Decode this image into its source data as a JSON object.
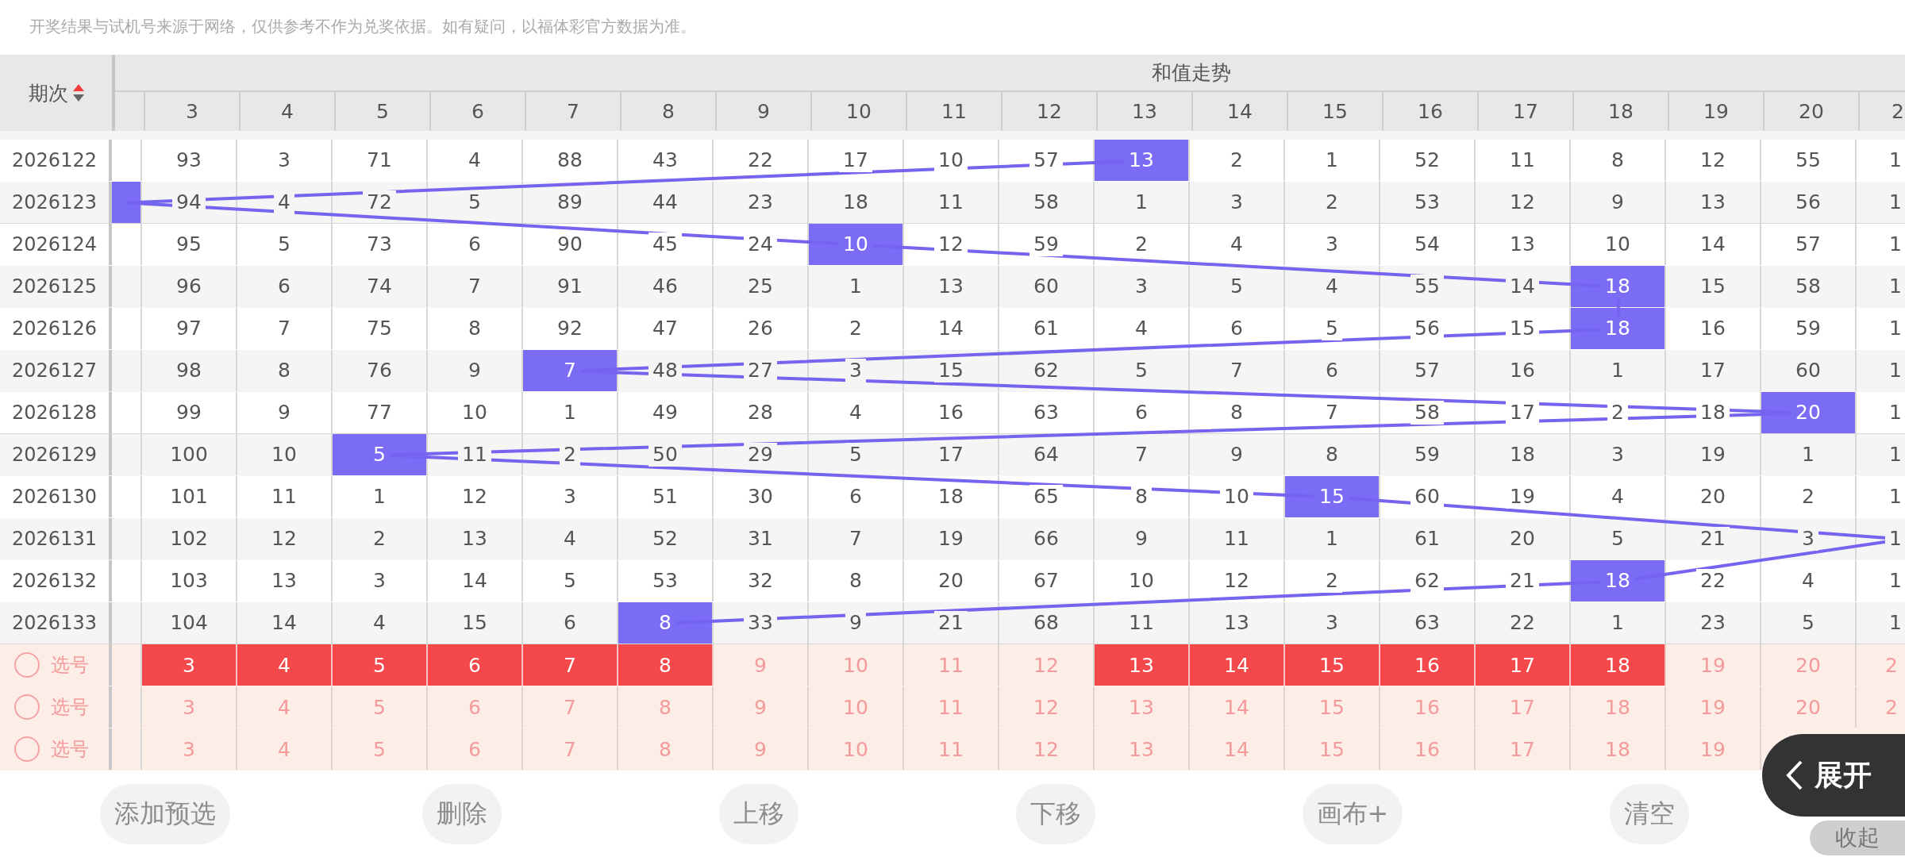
{
  "notice": "开奖结果与试机号来源于网络，仅供参考不作为兑奖依据。如有疑问，以福体彩官方数据为准。",
  "table": {
    "issue_header": "期次",
    "group_header": "和值走势",
    "columns": [
      "3",
      "4",
      "5",
      "6",
      "7",
      "8",
      "9",
      "10",
      "11",
      "12",
      "13",
      "14",
      "15",
      "16",
      "17",
      "18",
      "19",
      "20",
      "2"
    ],
    "rows": [
      {
        "issue": "2026122",
        "edge_hit": false,
        "beyond_hit": false,
        "cells": [
          {
            "text": "93",
            "hit": false
          },
          {
            "text": "3",
            "hit": false
          },
          {
            "text": "71",
            "hit": false
          },
          {
            "text": "4",
            "hit": false
          },
          {
            "text": "88",
            "hit": false
          },
          {
            "text": "43",
            "hit": false
          },
          {
            "text": "22",
            "hit": false
          },
          {
            "text": "17",
            "hit": false
          },
          {
            "text": "10",
            "hit": false
          },
          {
            "text": "57",
            "hit": false
          },
          {
            "text": "13",
            "hit": true
          },
          {
            "text": "2",
            "hit": false
          },
          {
            "text": "1",
            "hit": false
          },
          {
            "text": "52",
            "hit": false
          },
          {
            "text": "11",
            "hit": false
          },
          {
            "text": "8",
            "hit": false
          },
          {
            "text": "12",
            "hit": false
          },
          {
            "text": "55",
            "hit": false
          },
          {
            "text": "1",
            "hit": false
          }
        ]
      },
      {
        "issue": "2026123",
        "edge_hit": true,
        "beyond_hit": false,
        "cells": [
          {
            "text": "94",
            "hit": false
          },
          {
            "text": "4",
            "hit": false
          },
          {
            "text": "72",
            "hit": false
          },
          {
            "text": "5",
            "hit": false
          },
          {
            "text": "89",
            "hit": false
          },
          {
            "text": "44",
            "hit": false
          },
          {
            "text": "23",
            "hit": false
          },
          {
            "text": "18",
            "hit": false
          },
          {
            "text": "11",
            "hit": false
          },
          {
            "text": "58",
            "hit": false
          },
          {
            "text": "1",
            "hit": false
          },
          {
            "text": "3",
            "hit": false
          },
          {
            "text": "2",
            "hit": false
          },
          {
            "text": "53",
            "hit": false
          },
          {
            "text": "12",
            "hit": false
          },
          {
            "text": "9",
            "hit": false
          },
          {
            "text": "13",
            "hit": false
          },
          {
            "text": "56",
            "hit": false
          },
          {
            "text": "1",
            "hit": false
          }
        ]
      },
      {
        "issue": "2026124",
        "edge_hit": false,
        "beyond_hit": false,
        "cells": [
          {
            "text": "95",
            "hit": false
          },
          {
            "text": "5",
            "hit": false
          },
          {
            "text": "73",
            "hit": false
          },
          {
            "text": "6",
            "hit": false
          },
          {
            "text": "90",
            "hit": false
          },
          {
            "text": "45",
            "hit": false
          },
          {
            "text": "24",
            "hit": false
          },
          {
            "text": "10",
            "hit": true
          },
          {
            "text": "12",
            "hit": false
          },
          {
            "text": "59",
            "hit": false
          },
          {
            "text": "2",
            "hit": false
          },
          {
            "text": "4",
            "hit": false
          },
          {
            "text": "3",
            "hit": false
          },
          {
            "text": "54",
            "hit": false
          },
          {
            "text": "13",
            "hit": false
          },
          {
            "text": "10",
            "hit": false
          },
          {
            "text": "14",
            "hit": false
          },
          {
            "text": "57",
            "hit": false
          },
          {
            "text": "1",
            "hit": false
          }
        ]
      },
      {
        "issue": "2026125",
        "edge_hit": false,
        "beyond_hit": false,
        "cells": [
          {
            "text": "96",
            "hit": false
          },
          {
            "text": "6",
            "hit": false
          },
          {
            "text": "74",
            "hit": false
          },
          {
            "text": "7",
            "hit": false
          },
          {
            "text": "91",
            "hit": false
          },
          {
            "text": "46",
            "hit": false
          },
          {
            "text": "25",
            "hit": false
          },
          {
            "text": "1",
            "hit": false
          },
          {
            "text": "13",
            "hit": false
          },
          {
            "text": "60",
            "hit": false
          },
          {
            "text": "3",
            "hit": false
          },
          {
            "text": "5",
            "hit": false
          },
          {
            "text": "4",
            "hit": false
          },
          {
            "text": "55",
            "hit": false
          },
          {
            "text": "14",
            "hit": false
          },
          {
            "text": "18",
            "hit": true
          },
          {
            "text": "15",
            "hit": false
          },
          {
            "text": "58",
            "hit": false
          },
          {
            "text": "1",
            "hit": false
          }
        ]
      },
      {
        "issue": "2026126",
        "edge_hit": false,
        "beyond_hit": false,
        "cells": [
          {
            "text": "97",
            "hit": false
          },
          {
            "text": "7",
            "hit": false
          },
          {
            "text": "75",
            "hit": false
          },
          {
            "text": "8",
            "hit": false
          },
          {
            "text": "92",
            "hit": false
          },
          {
            "text": "47",
            "hit": false
          },
          {
            "text": "26",
            "hit": false
          },
          {
            "text": "2",
            "hit": false
          },
          {
            "text": "14",
            "hit": false
          },
          {
            "text": "61",
            "hit": false
          },
          {
            "text": "4",
            "hit": false
          },
          {
            "text": "6",
            "hit": false
          },
          {
            "text": "5",
            "hit": false
          },
          {
            "text": "56",
            "hit": false
          },
          {
            "text": "15",
            "hit": false
          },
          {
            "text": "18",
            "hit": true
          },
          {
            "text": "16",
            "hit": false
          },
          {
            "text": "59",
            "hit": false
          },
          {
            "text": "1",
            "hit": false
          }
        ]
      },
      {
        "issue": "2026127",
        "edge_hit": false,
        "beyond_hit": false,
        "cells": [
          {
            "text": "98",
            "hit": false
          },
          {
            "text": "8",
            "hit": false
          },
          {
            "text": "76",
            "hit": false
          },
          {
            "text": "9",
            "hit": false
          },
          {
            "text": "7",
            "hit": true
          },
          {
            "text": "48",
            "hit": false
          },
          {
            "text": "27",
            "hit": false
          },
          {
            "text": "3",
            "hit": false
          },
          {
            "text": "15",
            "hit": false
          },
          {
            "text": "62",
            "hit": false
          },
          {
            "text": "5",
            "hit": false
          },
          {
            "text": "7",
            "hit": false
          },
          {
            "text": "6",
            "hit": false
          },
          {
            "text": "57",
            "hit": false
          },
          {
            "text": "16",
            "hit": false
          },
          {
            "text": "1",
            "hit": false
          },
          {
            "text": "17",
            "hit": false
          },
          {
            "text": "60",
            "hit": false
          },
          {
            "text": "1",
            "hit": false
          }
        ]
      },
      {
        "issue": "2026128",
        "edge_hit": false,
        "beyond_hit": false,
        "cells": [
          {
            "text": "99",
            "hit": false
          },
          {
            "text": "9",
            "hit": false
          },
          {
            "text": "77",
            "hit": false
          },
          {
            "text": "10",
            "hit": false
          },
          {
            "text": "1",
            "hit": false
          },
          {
            "text": "49",
            "hit": false
          },
          {
            "text": "28",
            "hit": false
          },
          {
            "text": "4",
            "hit": false
          },
          {
            "text": "16",
            "hit": false
          },
          {
            "text": "63",
            "hit": false
          },
          {
            "text": "6",
            "hit": false
          },
          {
            "text": "8",
            "hit": false
          },
          {
            "text": "7",
            "hit": false
          },
          {
            "text": "58",
            "hit": false
          },
          {
            "text": "17",
            "hit": false
          },
          {
            "text": "2",
            "hit": false
          },
          {
            "text": "18",
            "hit": false
          },
          {
            "text": "20",
            "hit": true
          },
          {
            "text": "1",
            "hit": false
          }
        ]
      },
      {
        "issue": "2026129",
        "edge_hit": false,
        "beyond_hit": false,
        "cells": [
          {
            "text": "100",
            "hit": false
          },
          {
            "text": "10",
            "hit": false
          },
          {
            "text": "5",
            "hit": true
          },
          {
            "text": "11",
            "hit": false
          },
          {
            "text": "2",
            "hit": false
          },
          {
            "text": "50",
            "hit": false
          },
          {
            "text": "29",
            "hit": false
          },
          {
            "text": "5",
            "hit": false
          },
          {
            "text": "17",
            "hit": false
          },
          {
            "text": "64",
            "hit": false
          },
          {
            "text": "7",
            "hit": false
          },
          {
            "text": "9",
            "hit": false
          },
          {
            "text": "8",
            "hit": false
          },
          {
            "text": "59",
            "hit": false
          },
          {
            "text": "18",
            "hit": false
          },
          {
            "text": "3",
            "hit": false
          },
          {
            "text": "19",
            "hit": false
          },
          {
            "text": "1",
            "hit": false
          },
          {
            "text": "1",
            "hit": false
          }
        ]
      },
      {
        "issue": "2026130",
        "edge_hit": false,
        "beyond_hit": false,
        "cells": [
          {
            "text": "101",
            "hit": false
          },
          {
            "text": "11",
            "hit": false
          },
          {
            "text": "1",
            "hit": false
          },
          {
            "text": "12",
            "hit": false
          },
          {
            "text": "3",
            "hit": false
          },
          {
            "text": "51",
            "hit": false
          },
          {
            "text": "30",
            "hit": false
          },
          {
            "text": "6",
            "hit": false
          },
          {
            "text": "18",
            "hit": false
          },
          {
            "text": "65",
            "hit": false
          },
          {
            "text": "8",
            "hit": false
          },
          {
            "text": "10",
            "hit": false
          },
          {
            "text": "15",
            "hit": true
          },
          {
            "text": "60",
            "hit": false
          },
          {
            "text": "19",
            "hit": false
          },
          {
            "text": "4",
            "hit": false
          },
          {
            "text": "20",
            "hit": false
          },
          {
            "text": "2",
            "hit": false
          },
          {
            "text": "1",
            "hit": false
          }
        ]
      },
      {
        "issue": "2026131",
        "edge_hit": false,
        "beyond_hit": true,
        "cells": [
          {
            "text": "102",
            "hit": false
          },
          {
            "text": "12",
            "hit": false
          },
          {
            "text": "2",
            "hit": false
          },
          {
            "text": "13",
            "hit": false
          },
          {
            "text": "4",
            "hit": false
          },
          {
            "text": "52",
            "hit": false
          },
          {
            "text": "31",
            "hit": false
          },
          {
            "text": "7",
            "hit": false
          },
          {
            "text": "19",
            "hit": false
          },
          {
            "text": "66",
            "hit": false
          },
          {
            "text": "9",
            "hit": false
          },
          {
            "text": "11",
            "hit": false
          },
          {
            "text": "1",
            "hit": false
          },
          {
            "text": "61",
            "hit": false
          },
          {
            "text": "20",
            "hit": false
          },
          {
            "text": "5",
            "hit": false
          },
          {
            "text": "21",
            "hit": false
          },
          {
            "text": "3",
            "hit": false
          },
          {
            "text": "1",
            "hit": false
          }
        ]
      },
      {
        "issue": "2026132",
        "edge_hit": false,
        "beyond_hit": false,
        "cells": [
          {
            "text": "103",
            "hit": false
          },
          {
            "text": "13",
            "hit": false
          },
          {
            "text": "3",
            "hit": false
          },
          {
            "text": "14",
            "hit": false
          },
          {
            "text": "5",
            "hit": false
          },
          {
            "text": "53",
            "hit": false
          },
          {
            "text": "32",
            "hit": false
          },
          {
            "text": "8",
            "hit": false
          },
          {
            "text": "20",
            "hit": false
          },
          {
            "text": "67",
            "hit": false
          },
          {
            "text": "10",
            "hit": false
          },
          {
            "text": "12",
            "hit": false
          },
          {
            "text": "2",
            "hit": false
          },
          {
            "text": "62",
            "hit": false
          },
          {
            "text": "21",
            "hit": false
          },
          {
            "text": "18",
            "hit": true
          },
          {
            "text": "22",
            "hit": false
          },
          {
            "text": "4",
            "hit": false
          },
          {
            "text": "1",
            "hit": false
          }
        ]
      },
      {
        "issue": "2026133",
        "edge_hit": false,
        "beyond_hit": false,
        "cells": [
          {
            "text": "104",
            "hit": false
          },
          {
            "text": "14",
            "hit": false
          },
          {
            "text": "4",
            "hit": false
          },
          {
            "text": "15",
            "hit": false
          },
          {
            "text": "6",
            "hit": false
          },
          {
            "text": "8",
            "hit": true
          },
          {
            "text": "33",
            "hit": false
          },
          {
            "text": "9",
            "hit": false
          },
          {
            "text": "21",
            "hit": false
          },
          {
            "text": "68",
            "hit": false
          },
          {
            "text": "11",
            "hit": false
          },
          {
            "text": "13",
            "hit": false
          },
          {
            "text": "3",
            "hit": false
          },
          {
            "text": "63",
            "hit": false
          },
          {
            "text": "22",
            "hit": false
          },
          {
            "text": "1",
            "hit": false
          },
          {
            "text": "23",
            "hit": false
          },
          {
            "text": "5",
            "hit": false
          },
          {
            "text": "1",
            "hit": false
          }
        ]
      }
    ],
    "pick_rows": [
      {
        "label": "选号",
        "checked": false,
        "cells": [
          {
            "text": "3",
            "selected": true
          },
          {
            "text": "4",
            "selected": true
          },
          {
            "text": "5",
            "selected": true
          },
          {
            "text": "6",
            "selected": true
          },
          {
            "text": "7",
            "selected": true
          },
          {
            "text": "8",
            "selected": true
          },
          {
            "text": "9",
            "selected": false
          },
          {
            "text": "10",
            "selected": false
          },
          {
            "text": "11",
            "selected": false
          },
          {
            "text": "12",
            "selected": false
          },
          {
            "text": "13",
            "selected": true
          },
          {
            "text": "14",
            "selected": true
          },
          {
            "text": "15",
            "selected": true
          },
          {
            "text": "16",
            "selected": true
          },
          {
            "text": "17",
            "selected": true
          },
          {
            "text": "18",
            "selected": true
          },
          {
            "text": "19",
            "selected": false
          },
          {
            "text": "20",
            "selected": false
          },
          {
            "text": "2",
            "selected": false
          }
        ]
      },
      {
        "label": "选号",
        "checked": false,
        "cells": [
          {
            "text": "3",
            "selected": false
          },
          {
            "text": "4",
            "selected": false
          },
          {
            "text": "5",
            "selected": false
          },
          {
            "text": "6",
            "selected": false
          },
          {
            "text": "7",
            "selected": false
          },
          {
            "text": "8",
            "selected": false
          },
          {
            "text": "9",
            "selected": false
          },
          {
            "text": "10",
            "selected": false
          },
          {
            "text": "11",
            "selected": false
          },
          {
            "text": "12",
            "selected": false
          },
          {
            "text": "13",
            "selected": false
          },
          {
            "text": "14",
            "selected": false
          },
          {
            "text": "15",
            "selected": false
          },
          {
            "text": "16",
            "selected": false
          },
          {
            "text": "17",
            "selected": false
          },
          {
            "text": "18",
            "selected": false
          },
          {
            "text": "19",
            "selected": false
          },
          {
            "text": "20",
            "selected": false
          },
          {
            "text": "2",
            "selected": false
          }
        ]
      },
      {
        "label": "选号",
        "checked": false,
        "cells": [
          {
            "text": "3",
            "selected": false
          },
          {
            "text": "4",
            "selected": false
          },
          {
            "text": "5",
            "selected": false
          },
          {
            "text": "6",
            "selected": false
          },
          {
            "text": "7",
            "selected": false
          },
          {
            "text": "8",
            "selected": false
          },
          {
            "text": "9",
            "selected": false
          },
          {
            "text": "10",
            "selected": false
          },
          {
            "text": "11",
            "selected": false
          },
          {
            "text": "12",
            "selected": false
          },
          {
            "text": "13",
            "selected": false
          },
          {
            "text": "14",
            "selected": false
          },
          {
            "text": "15",
            "selected": false
          },
          {
            "text": "16",
            "selected": false
          },
          {
            "text": "17",
            "selected": false
          },
          {
            "text": "18",
            "selected": false
          },
          {
            "text": "19",
            "selected": false
          }
        ]
      }
    ]
  },
  "buttons": [
    "添加预选",
    "删除",
    "上移",
    "下移",
    "画布+",
    "清空"
  ],
  "floating": {
    "expand": "展开",
    "collapse": "收起"
  }
}
